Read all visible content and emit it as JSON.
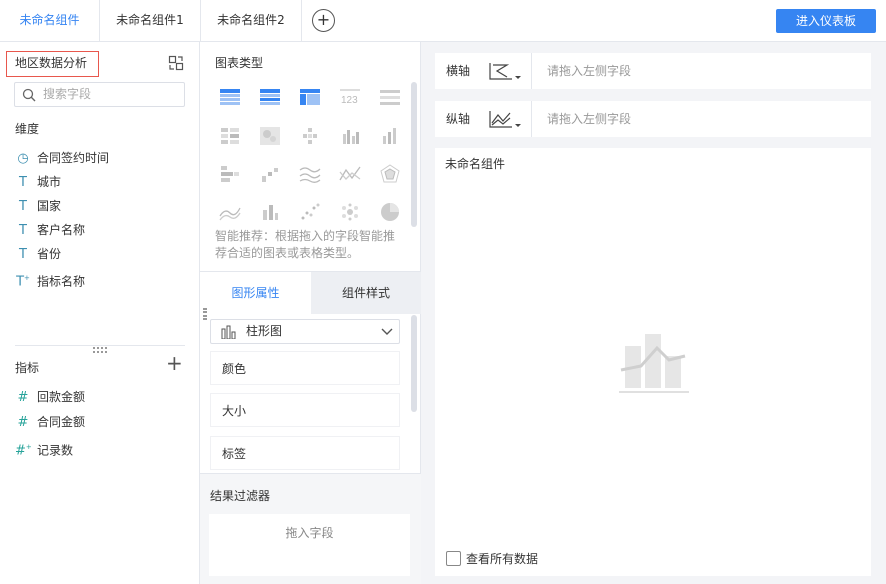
{
  "tabs": [
    {
      "label": "未命名组件",
      "active": true
    },
    {
      "label": "未命名组件1",
      "active": false
    },
    {
      "label": "未命名组件2",
      "active": false
    }
  ],
  "add_tab_icon": "plus-circle-icon",
  "enter_dashboard_label": "进入仪表板",
  "left_panel": {
    "dataset_title": "地区数据分析",
    "search_placeholder": "搜索字段",
    "dimensions_label": "维度",
    "dimensions": [
      {
        "label": "合同签约时间",
        "type": "date"
      },
      {
        "label": "城市",
        "type": "text"
      },
      {
        "label": "国家",
        "type": "text"
      },
      {
        "label": "客户名称",
        "type": "text"
      },
      {
        "label": "省份",
        "type": "text"
      },
      {
        "label": "指标名称",
        "type": "text-calc"
      }
    ],
    "measures_label": "指标",
    "measures": [
      {
        "label": "回款金额",
        "type": "number"
      },
      {
        "label": "合同金额",
        "type": "number"
      },
      {
        "label": "记录数",
        "type": "number-calc"
      }
    ]
  },
  "mid_panel": {
    "chart_types_label": "图表类型",
    "hint": "智能推荐：根据拖入的字段智能推荐合适的图表或表格类型。",
    "tab_graph_props": "图形属性",
    "tab_component_style": "组件样式",
    "chart_select_value": "柱形图",
    "props": [
      "颜色",
      "大小",
      "标签"
    ],
    "filter_title": "结果过滤器",
    "filter_drop_hint": "拖入字段"
  },
  "right_panel": {
    "x_axis_label": "横轴",
    "y_axis_label": "纵轴",
    "drop_hint": "请拖入左侧字段",
    "widget_title": "未命名组件",
    "show_all_data": "查看所有数据"
  },
  "colors": {
    "accent": "#3685f2",
    "highlight_border": "#e8574d",
    "dim_icon": "#3d8fb0",
    "measure_icon": "#27a39a"
  }
}
